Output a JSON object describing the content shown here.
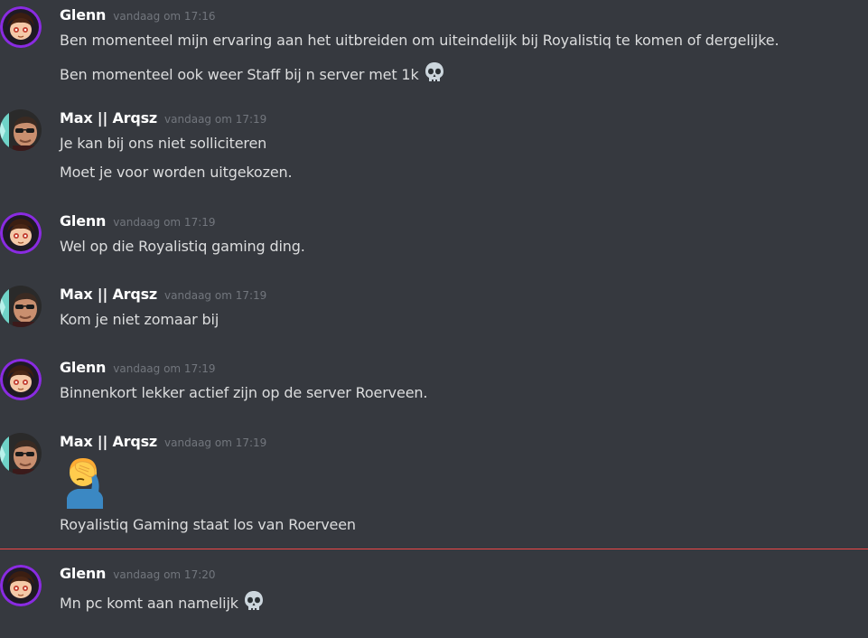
{
  "timestamp_prefix": "vandaag om",
  "messages": [
    {
      "author": "Glenn",
      "time": "vandaag om 17:16",
      "lines": [
        "Ben momenteel mijn ervaring aan het uitbreiden om uiteindelijk bij Royalistiq te komen of dergelijke.",
        "Ben momenteel ook weer Staff bij n server met 1k"
      ],
      "line_emoji": "skull-icon"
    },
    {
      "author": "Max || Arqsz",
      "time": "vandaag om 17:19",
      "lines": [
        "Je kan bij ons niet solliciteren",
        "Moet je voor worden uitgekozen."
      ]
    },
    {
      "author": "Glenn",
      "time": "vandaag om 17:19",
      "lines": [
        "Wel op die Royalistiq gaming ding."
      ]
    },
    {
      "author": "Max || Arqsz",
      "time": "vandaag om 17:19",
      "lines": [
        "Kom je niet zomaar bij"
      ]
    },
    {
      "author": "Glenn",
      "time": "vandaag om 17:19",
      "lines": [
        "Binnenkort lekker actief zijn op de server Roerveen."
      ]
    },
    {
      "author": "Max || Arqsz",
      "time": "vandaag om 17:19",
      "big_emoji": "facepalm-icon",
      "lines": [
        "Royalistiq Gaming  staat los van Roerveen"
      ]
    },
    {
      "author": "Glenn",
      "time": "vandaag om 17:20",
      "lines": [
        "Mn pc komt aan namelijk"
      ],
      "line_emoji": "skull-icon"
    }
  ],
  "colors": {
    "background": "#36393f",
    "author": "#ffffff",
    "text": "#dcddde",
    "timestamp": "#72767d",
    "new_messages_divider": "#f04747",
    "glenn_avatar_ring": "#8a2be2"
  }
}
